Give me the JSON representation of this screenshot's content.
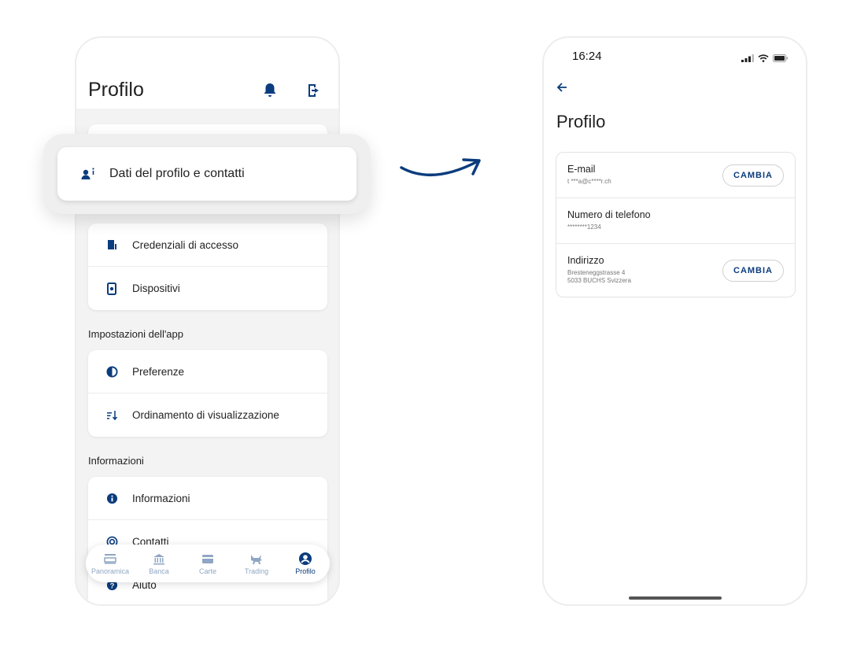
{
  "left": {
    "title": "Profilo",
    "popout_label": "Dati del profilo e contatti",
    "sections": [
      {
        "label": "",
        "items": [
          "Credenziali di accesso",
          "Dispositivi"
        ]
      },
      {
        "label": "Impostazioni dell'app",
        "items": [
          "Preferenze",
          "Ordinamento di visualizzazione"
        ]
      },
      {
        "label": "Informazioni",
        "items": [
          "Informazioni",
          "Contatti",
          "Aiuto"
        ]
      }
    ],
    "nav": [
      "Panoramica",
      "Banca",
      "Carte",
      "Trading",
      "Profilo"
    ]
  },
  "right": {
    "time": "16:24",
    "title": "Profilo",
    "rows": [
      {
        "title": "E-mail",
        "value": "t ***a@c****r.ch",
        "button": "CAMBIA"
      },
      {
        "title": "Numero di telefono",
        "value": "********1234"
      },
      {
        "title": "Indirizzo",
        "value_line1": "Bresteneggstrasse 4",
        "value_line2": "5033 BUCHS Svizzera",
        "button": "CAMBIA"
      }
    ]
  },
  "colors": {
    "accent": "#0b3c7d",
    "nav_inactive": "#8fa6c4"
  }
}
